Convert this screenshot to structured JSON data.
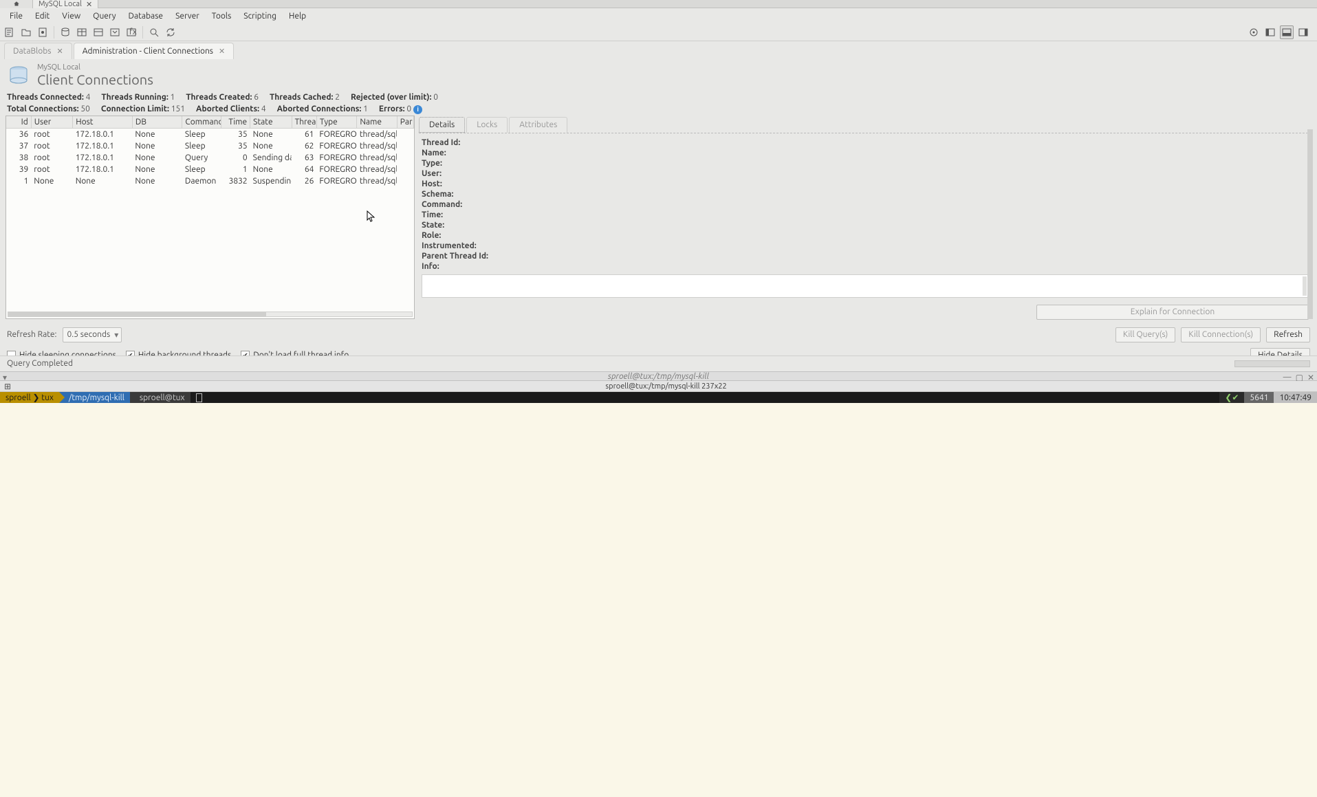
{
  "conn_tabs": {
    "active": "MySQL Local"
  },
  "menu": [
    "File",
    "Edit",
    "View",
    "Query",
    "Database",
    "Server",
    "Tools",
    "Scripting",
    "Help"
  ],
  "doc_tabs": [
    {
      "label": "DataBlobs",
      "active": false
    },
    {
      "label": "Administration - Client Connections",
      "active": true
    }
  ],
  "page": {
    "subtitle": "MySQL Local",
    "title": "Client Connections"
  },
  "stats_row1": {
    "threads_connected_l": "Threads Connected:",
    "threads_connected_v": "4",
    "threads_running_l": "Threads Running:",
    "threads_running_v": "1",
    "threads_created_l": "Threads Created:",
    "threads_created_v": "6",
    "threads_cached_l": "Threads Cached:",
    "threads_cached_v": "2",
    "rejected_l": "Rejected (over limit):",
    "rejected_v": "0"
  },
  "stats_row2": {
    "total_conn_l": "Total Connections:",
    "total_conn_v": "50",
    "conn_limit_l": "Connection Limit:",
    "conn_limit_v": "151",
    "aborted_clients_l": "Aborted Clients:",
    "aborted_clients_v": "4",
    "aborted_conn_l": "Aborted Connections:",
    "aborted_conn_v": "1",
    "errors_l": "Errors:",
    "errors_v": "0"
  },
  "columns": [
    "Id",
    "User",
    "Host",
    "DB",
    "Command",
    "Time",
    "State",
    "Thread",
    "Type",
    "Name",
    "Par"
  ],
  "rows": [
    {
      "id": "36",
      "user": "root",
      "host": "172.18.0.1",
      "db": "None",
      "cmd": "Sleep",
      "time": "35",
      "state": "None",
      "thread": "61",
      "type": "FOREGROUNI",
      "name": "thread/sql/on"
    },
    {
      "id": "37",
      "user": "root",
      "host": "172.18.0.1",
      "db": "None",
      "cmd": "Sleep",
      "time": "35",
      "state": "None",
      "thread": "62",
      "type": "FOREGROUNI",
      "name": "thread/sql/on"
    },
    {
      "id": "38",
      "user": "root",
      "host": "172.18.0.1",
      "db": "None",
      "cmd": "Query",
      "time": "0",
      "state": "Sending data",
      "thread": "63",
      "type": "FOREGROUNI",
      "name": "thread/sql/on"
    },
    {
      "id": "39",
      "user": "root",
      "host": "172.18.0.1",
      "db": "None",
      "cmd": "Sleep",
      "time": "1",
      "state": "None",
      "thread": "64",
      "type": "FOREGROUNI",
      "name": "thread/sql/on"
    },
    {
      "id": "1",
      "user": "None",
      "host": "None",
      "db": "None",
      "cmd": "Daemon",
      "time": "3832",
      "state": "Suspending",
      "thread": "26",
      "type": "FOREGROUNI",
      "name": "thread/sql/co"
    }
  ],
  "detail_tabs": [
    "Details",
    "Locks",
    "Attributes"
  ],
  "detail_keys": {
    "thread_id": "Thread Id:",
    "name": "Name:",
    "type": "Type:",
    "user": "User:",
    "host": "Host:",
    "schema": "Schema:",
    "command": "Command:",
    "time": "Time:",
    "state": "State:",
    "role": "Role:",
    "instrumented": "Instrumented:",
    "parent": "Parent Thread Id:",
    "info": "Info:"
  },
  "buttons": {
    "explain": "Explain for Connection",
    "kill_query": "Kill Query(s)",
    "kill_conn": "Kill Connection(s)",
    "refresh": "Refresh",
    "hide_details": "Hide Details"
  },
  "refresh_rate_l": "Refresh Rate:",
  "refresh_rate_v": "0.5 seconds",
  "checks": {
    "hide_sleeping": "Hide sleeping connections",
    "hide_background": "Hide background threads",
    "dont_load": "Don't load full thread info"
  },
  "status": "Query Completed",
  "term": {
    "title_top": "sproell@tux:/tmp/mysql-kill",
    "title_tab": "sproell@tux:/tmp/mysql-kill 237x22",
    "seg1": "sproell",
    "seg1b": "tux",
    "seg2": "/tmp/mysql-kill",
    "seg3": "sproell@tux",
    "rnum": "5641",
    "rtime": "10:47:49",
    "check": "✔"
  }
}
